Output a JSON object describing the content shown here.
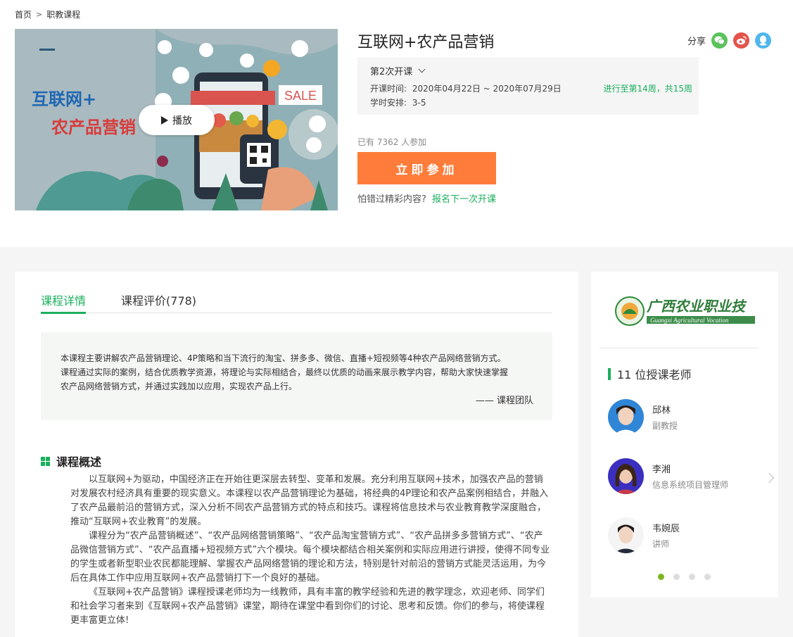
{
  "breadcrumb": {
    "home": "首页",
    "sep": ">",
    "current": "职教课程"
  },
  "cover": {
    "title_line1": "互联网+",
    "title_line2": "农产品营销",
    "sale": "SALE",
    "play_label": "播放"
  },
  "course": {
    "title": "互联网+农产品营销",
    "share_label": "分享",
    "session_label": "第2次开课",
    "time_label": "开课时间:",
    "time_value": "2020年04月22日 ~ 2020年07月29日",
    "hours_label": "学时安排:",
    "hours_value": "3-5",
    "progress": "进行至第14周，共15周",
    "joined": "已有 7362 人参加",
    "join_button": "立即参加",
    "miss_text": "怕错过精彩内容?",
    "miss_link": "报名下一次开课"
  },
  "tabs": [
    {
      "label": "课程详情"
    },
    {
      "label": "课程评价(778)"
    }
  ],
  "intro": {
    "line1": "本课程主要讲解农产品营销理论、4P策略和当下流行的淘宝、拼多多、微信、直播+短视频等4种农产品网络营销方式。",
    "line2": "课程通过实际的案例，结合优质教学资源，将理论与实际相结合，最终以优质的动画来展示教学内容，帮助大家快速掌握",
    "line3": "农产品网络营销方式，并通过实践加以应用，实现农产品上行。",
    "signature": "—— 课程团队"
  },
  "overview": {
    "heading": "课程概述",
    "p1": "以互联网+为驱动，中国经济正在开始往更深层去转型、变革和发展。充分利用互联网+技术，加强农产品的营销对发展农村经济具有重要的现实意义。本课程以农产品营销理论为基础，将经典的4P理论和农产品案例相结合，并融入了农产品最前沿的营销方式，深入分析不同农产品营销方式的特点和技巧。课程将信息技术与农业教育教学深度融合，推动“互联网+农业教育”的发展。",
    "p2": "课程分为“农产品营销概述”、“农产品网络营销策略”、“农产品淘宝营销方式”、“农产品拼多多营销方式”、“农产品微信营销方式”、“农产品直播+短视频方式”六个模块。每个模块都结合相关案例和实际应用进行讲授，使得不同专业的学生或者新型职业农民都能理解、掌握农产品网络营销的理论和方法，特别是针对前沿的营销方式能灵活运用，为今后在具体工作中应用互联网+农产品营销打下一个良好的基础。",
    "p3": "《互联网+农产品营销》课程授课老师均为一线教师，具有丰富的教学经验和先进的教学理念，欢迎老师、同学们和社会学习者来到《互联网+农产品营销》课堂，期待在课堂中看到你们的讨论、思考和反馈。你们的参与，将使课程更丰富更立体!"
  },
  "school": {
    "name_cn": "广西农业职业技",
    "name_en": "Guangxi Agricultural Vocation"
  },
  "teachers": {
    "heading": "11 位授课老师",
    "list": [
      {
        "name": "邱林",
        "title": "副教授"
      },
      {
        "name": "李湘",
        "title": "信息系统项目管理师"
      },
      {
        "name": "韦婉辰",
        "title": "讲师"
      }
    ]
  },
  "colors": {
    "accent": "#1aaf5d",
    "join": "#ff7c3a"
  }
}
